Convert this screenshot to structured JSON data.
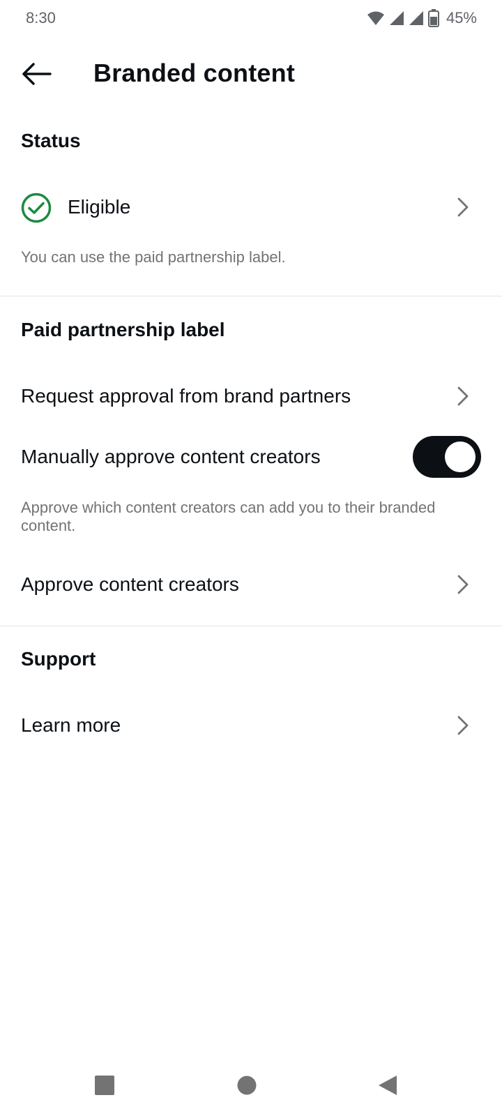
{
  "status_bar": {
    "time": "8:30",
    "battery": "45%",
    "icons": [
      "wifi-icon",
      "signal-icon",
      "signal-icon",
      "battery-icon"
    ]
  },
  "header": {
    "title": "Branded content",
    "back_icon": "back-arrow-icon"
  },
  "status_section": {
    "title": "Status",
    "status_label": "Eligible",
    "status_icon": "check-circle-icon",
    "status_color": "#1b8a3f",
    "helper": "You can use the paid partnership label."
  },
  "paid_partnership_section": {
    "title": "Paid partnership label",
    "request_approval_label": "Request approval from brand partners",
    "manual_approve_label": "Manually approve content creators",
    "manual_approve_enabled": true,
    "manual_approve_helper": "Approve which content creators can add you to their branded content.",
    "approve_creators_label": "Approve content creators"
  },
  "support_section": {
    "title": "Support",
    "learn_more_label": "Learn more"
  },
  "nav_bar": {
    "icons": [
      "recents-square-icon",
      "home-circle-icon",
      "back-triangle-icon"
    ]
  },
  "colors": {
    "text": "#0c1014",
    "secondary": "#737373",
    "toggle_on": "#0c1014",
    "divider": "#e6e6e6"
  }
}
